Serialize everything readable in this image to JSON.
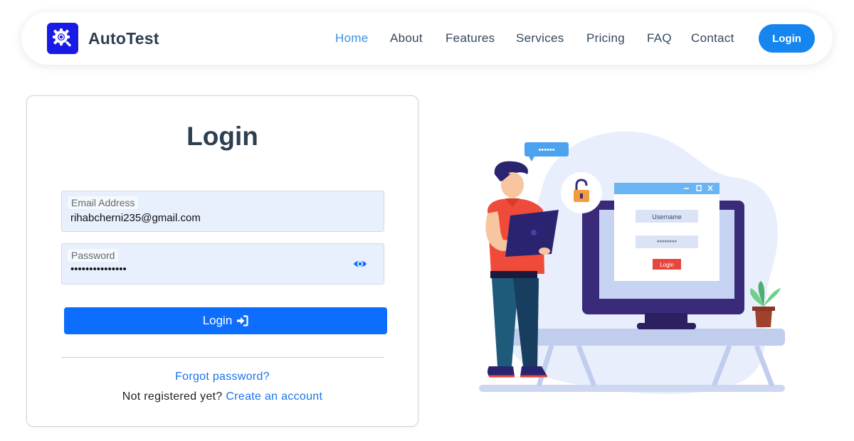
{
  "brand": {
    "name": "AutoTest",
    "logo_icon": "gear-search-icon"
  },
  "nav": {
    "links": [
      {
        "label": "Home",
        "active": true
      },
      {
        "label": "About",
        "active": false
      },
      {
        "label": "Features",
        "active": false
      },
      {
        "label": "Services",
        "active": false
      },
      {
        "label": "Pricing",
        "active": false
      },
      {
        "label": "FAQ",
        "active": false
      },
      {
        "label": "Contact",
        "active": false
      }
    ],
    "login_label": "Login"
  },
  "login_form": {
    "title": "Login",
    "email": {
      "label": "Email Address",
      "value": "rihabcherni235@gmail.com"
    },
    "password": {
      "label": "Password",
      "value": "•••••••••••••••",
      "toggle_icon": "eye-icon"
    },
    "submit_label": "Login",
    "submit_icon": "sign-in-icon",
    "forgot_label": "Forgot password?",
    "register_prompt": "Not registered yet?",
    "register_link": "Create an account"
  },
  "illustration": {
    "username_label": "Username",
    "password_mask": "********",
    "login_label": "Login",
    "bubble_text": "••••••"
  },
  "colors": {
    "primary": "#0d6efd",
    "nav_active": "#3b8fe0",
    "brand_logo": "#1a1ae6",
    "field_bg": "#e8f0fe",
    "link": "#1a73e8"
  }
}
